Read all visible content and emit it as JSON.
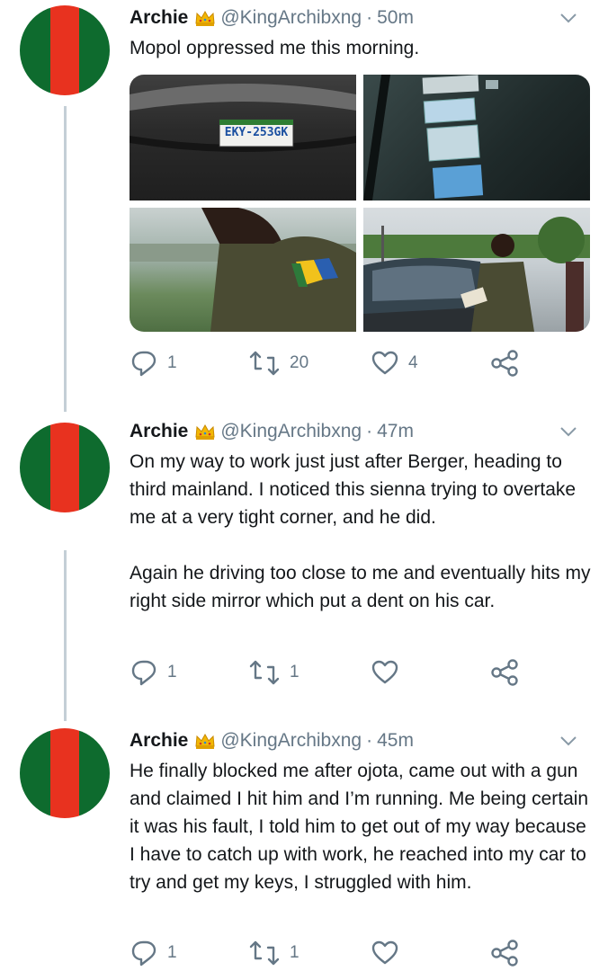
{
  "tweets": [
    {
      "name": "Archie",
      "handle": "@KingArchibxng",
      "time": "50m",
      "text": [
        "Mopol oppressed me this morning."
      ],
      "media": {
        "plate_text": "EKY-253GK"
      },
      "replies": "1",
      "retweets": "20",
      "likes": "4"
    },
    {
      "name": "Archie",
      "handle": "@KingArchibxng",
      "time": "47m",
      "text": [
        "On my way to work just just after Berger, heading to third mainland. I noticed this sienna trying to overtake me at a very tight corner, and he did.",
        "Again he driving too close to me and eventually hits my right side mirror which put a dent on his car."
      ],
      "replies": "1",
      "retweets": "1",
      "likes": ""
    },
    {
      "name": "Archie",
      "handle": "@KingArchibxng",
      "time": "45m",
      "text": [
        "He finally blocked me after ojota, came out with a gun and claimed I hit him and I’m running. Me being certain it was his fault, I told him to get out of my way because I have to catch up with work, he reached into my car to try and get my keys, I struggled with him."
      ],
      "replies": "1",
      "retweets": "1",
      "likes": ""
    }
  ],
  "separator": "·",
  "colors": {
    "avatar_green": "#0e6b2e",
    "avatar_red": "#e8321f",
    "secondary_text": "#657786",
    "thread_line": "#c4cfd6"
  },
  "icons": [
    "crown-icon",
    "chevron-down-icon",
    "reply-icon",
    "retweet-icon",
    "like-icon",
    "share-icon"
  ]
}
